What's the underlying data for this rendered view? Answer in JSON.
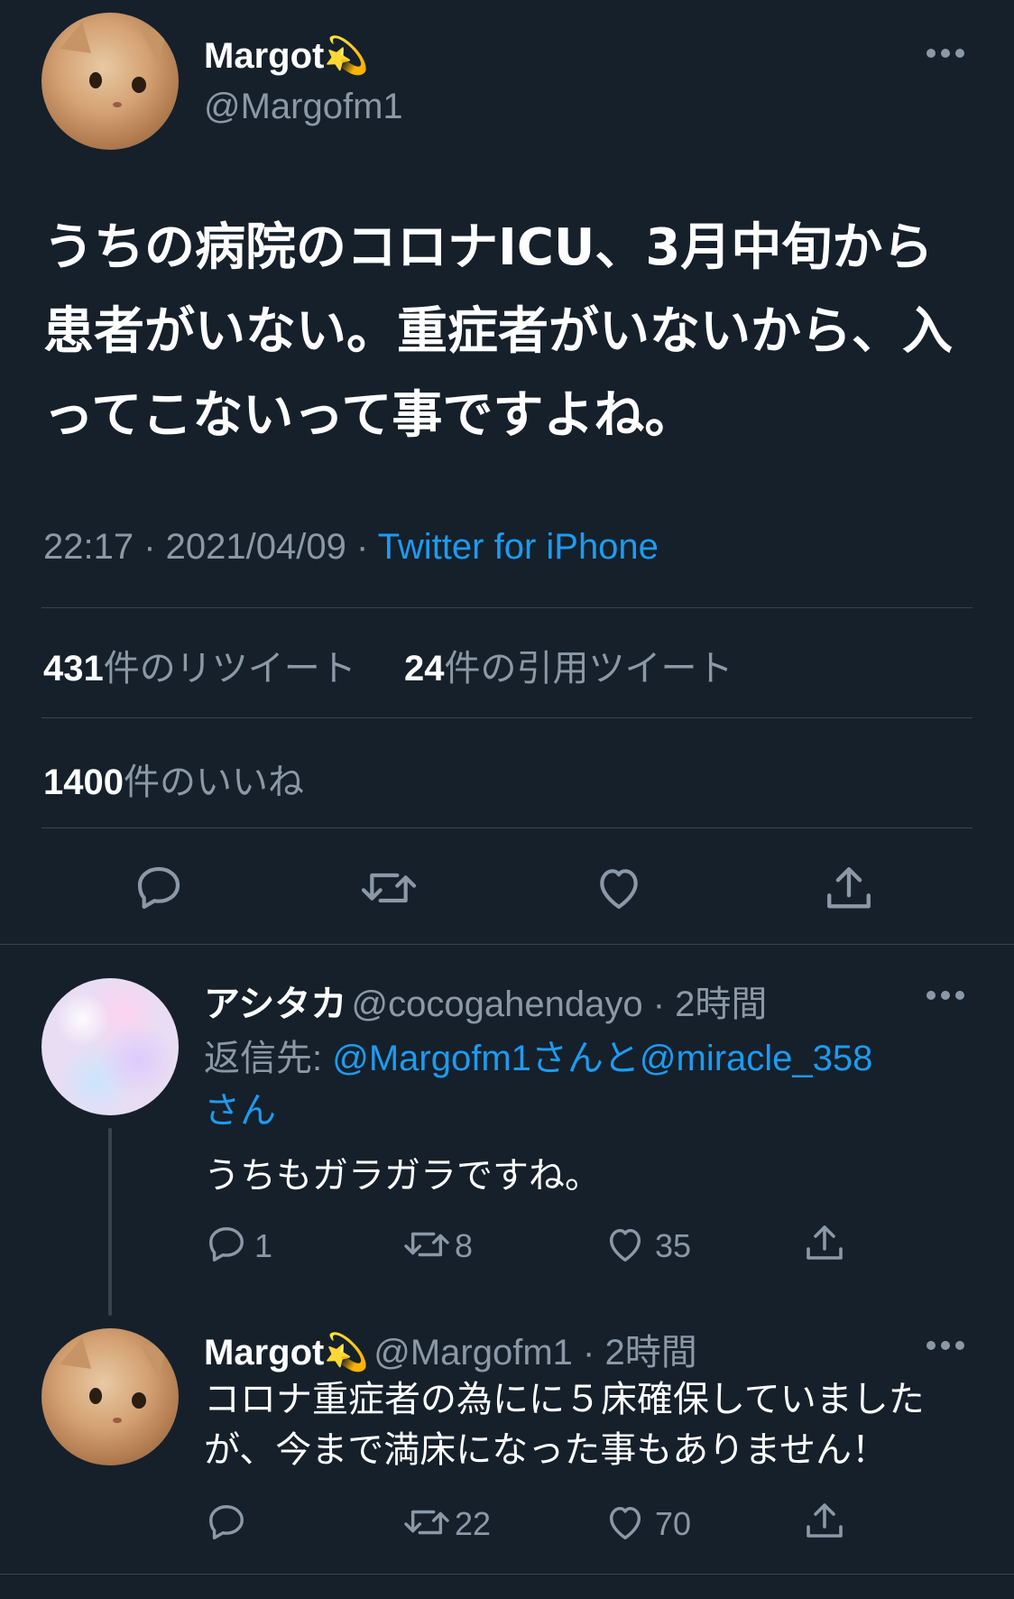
{
  "main_tweet": {
    "author_name": "Margot",
    "author_emoji": "💫",
    "author_handle": "@Margofm1",
    "more": "•••",
    "text": "うちの病院のコロナICU、3月中旬から患者がいない。重症者がいないから、入ってこないって事ですよね。",
    "time_date": "22:17 · 2021/04/09 · ",
    "source": "Twitter for iPhone",
    "retweets_count": "431",
    "retweets_label": "件のリツイート",
    "quotes_count": "24",
    "quotes_label": "件の引用ツイート",
    "likes_count": "1400",
    "likes_label": "件のいいね"
  },
  "replies": [
    {
      "author_name": "アシタカ",
      "author_handle": "@cocogahendayo",
      "time": " · 2時間",
      "more": "•••",
      "reply_prefix": "返信先: ",
      "reply_to": "@Margofm1さんと@miracle_358",
      "reply_to_line2": "さん",
      "text": "うちもガラガラですね。",
      "reply_count": "1",
      "retweet_count": "8",
      "like_count": "35"
    },
    {
      "author_name": "Margot",
      "author_emoji": "💫",
      "author_handle": "@Margofm1",
      "time": " · 2時間",
      "more": "•••",
      "text_line1": "コロナ重症者の為にに５床確保していました",
      "text_line2": "が、今まで満床になった事もありません！",
      "reply_count": "",
      "retweet_count": "22",
      "like_count": "70"
    }
  ],
  "icons": [
    "reply-icon",
    "retweet-icon",
    "like-icon",
    "share-icon",
    "more-icon"
  ],
  "colors": {
    "background": "#15202b",
    "accent": "#1d9bf0",
    "secondary_text": "#8b98a5",
    "divider": "#38444d"
  }
}
